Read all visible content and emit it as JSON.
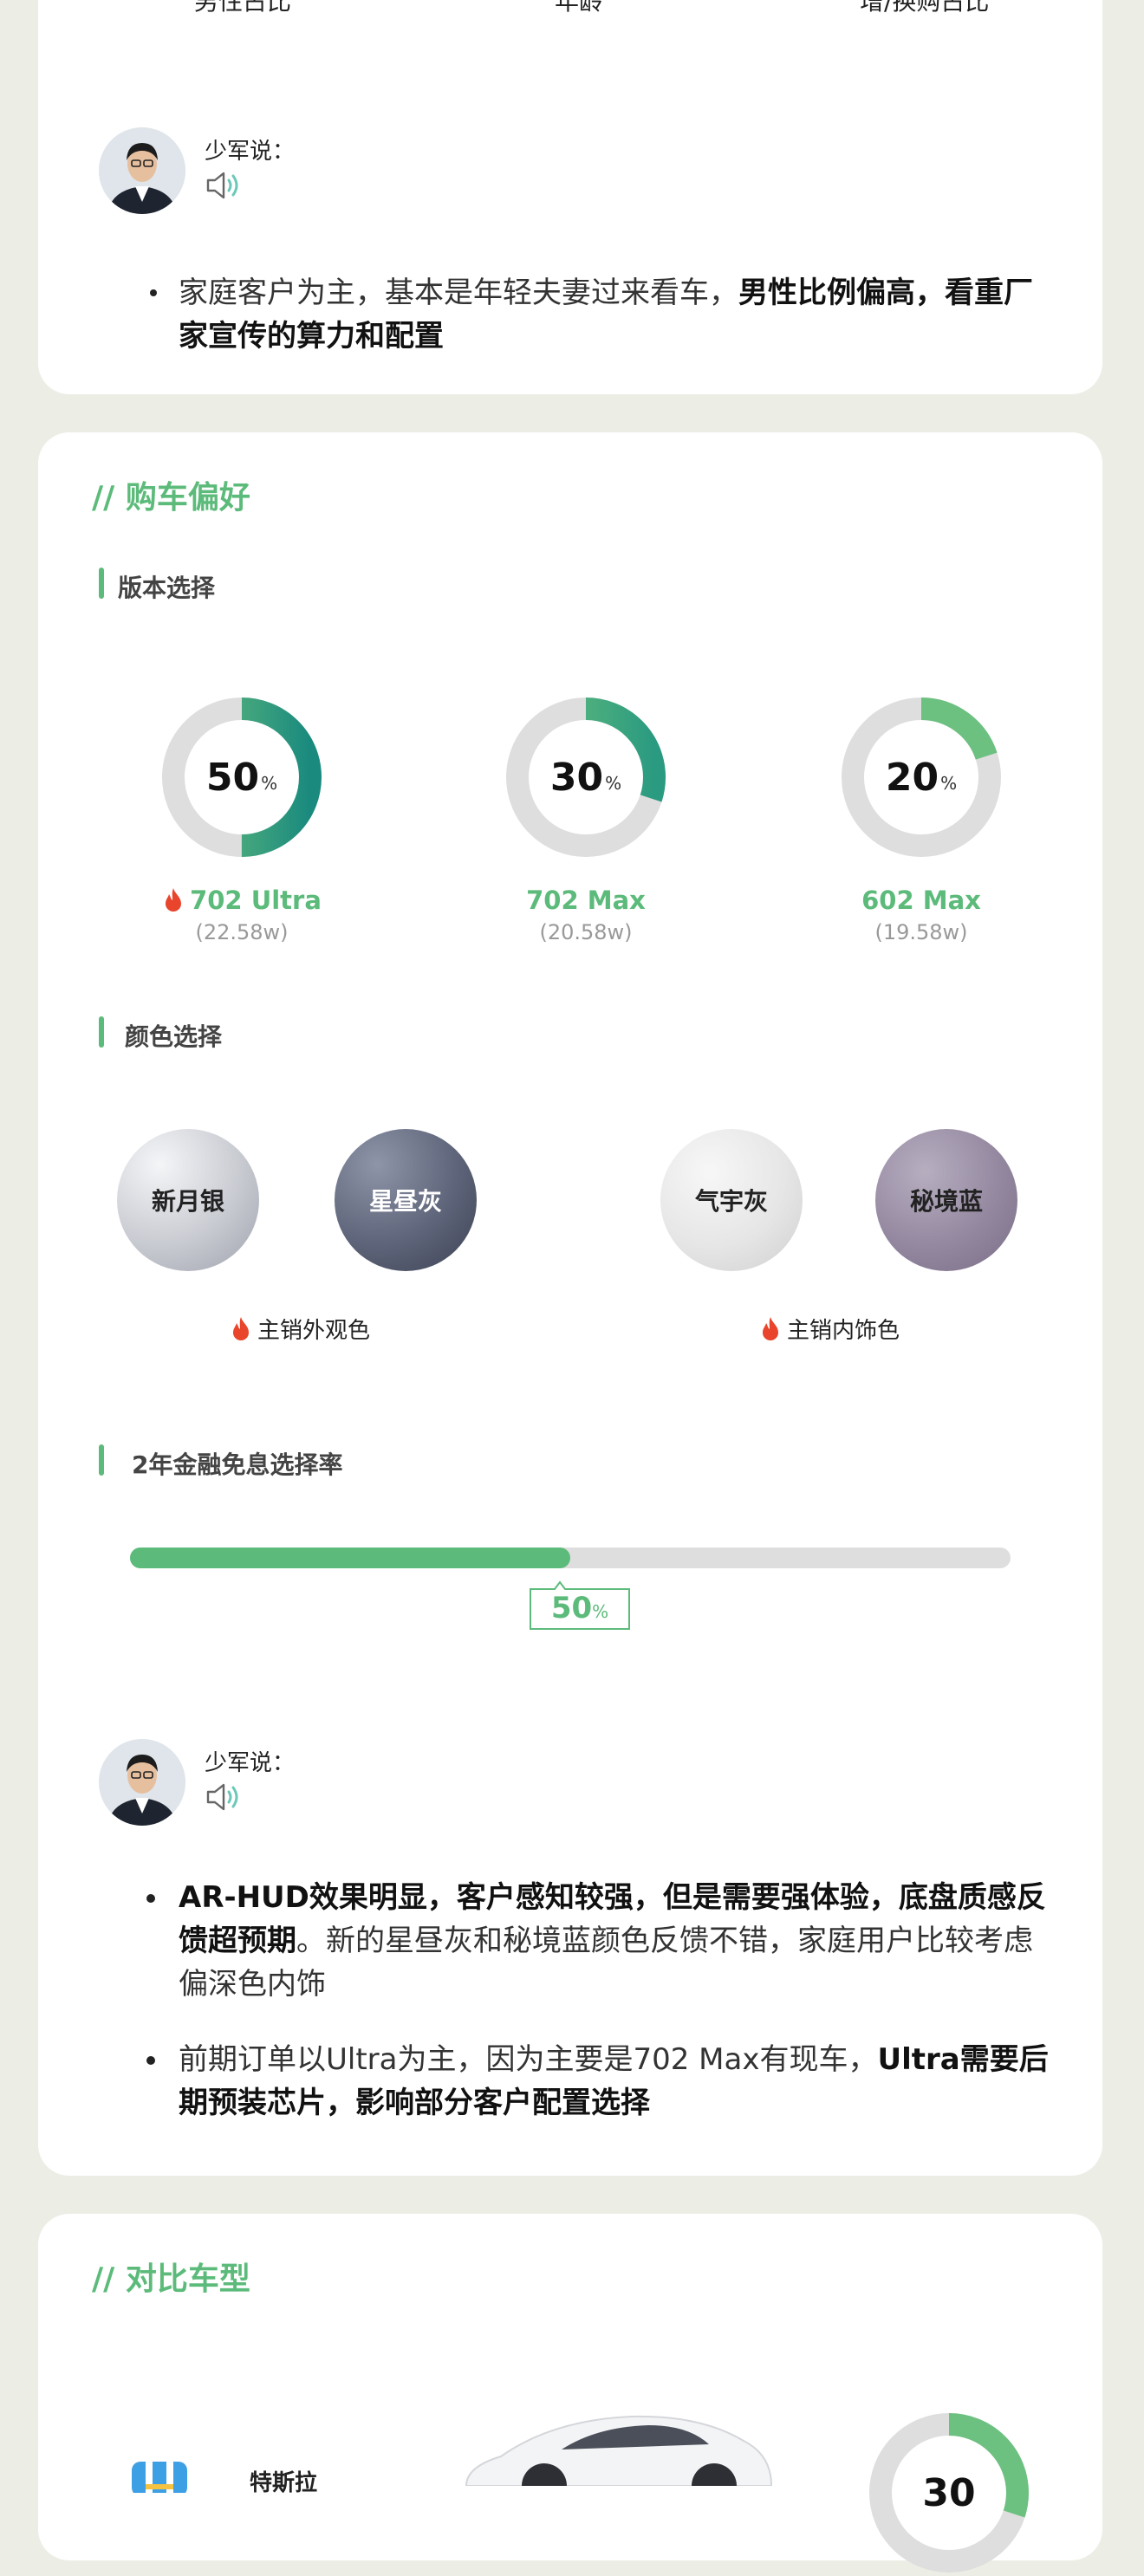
{
  "card1": {
    "top_labels": [
      "男性占比",
      "年龄",
      "增/换购占比"
    ],
    "say_label": "少军说：",
    "bullet": {
      "normal": "家庭客户为主，基本是年轻夫妻过来看车，",
      "bold": "男性比例偏高，看重厂家宣传的算力和配置"
    }
  },
  "card2": {
    "section_title": "// 购车偏好",
    "version_title": "版本选择",
    "versions": [
      {
        "value": "50",
        "pct": "%",
        "name": "702 Ultra",
        "price": "(22.58w)",
        "hot": true,
        "fraction": 0.5
      },
      {
        "value": "30",
        "pct": "%",
        "name": "702 Max",
        "price": "(20.58w)",
        "hot": false,
        "fraction": 0.3
      },
      {
        "value": "20",
        "pct": "%",
        "name": "602 Max",
        "price": "(19.58w)",
        "hot": false,
        "fraction": 0.2
      }
    ],
    "color_title": "颜色选择",
    "colors": [
      "新月银",
      "星昼灰",
      "气宇灰",
      "秘境蓝"
    ],
    "exterior_label": "主销外观色",
    "interior_label": "主销内饰色",
    "finance_title": "2年金融免息选择率",
    "finance": {
      "value": "50",
      "pct": "%",
      "fraction": 0.5
    },
    "say_label": "少军说：",
    "bullets": [
      {
        "bold": "AR-HUD效果明显，客户感知较强，但是需要强体验，底盘质感反馈超预期",
        "normal": "。新的星昼灰和秘境蓝颜色反馈不错，家庭用户比较考虑偏深色内饰"
      },
      {
        "normal": "前期订单以Ultra为主，因为主要是702 Max有现车，",
        "bold": "Ultra需要后期预装芯片，影响部分客户配置选择"
      }
    ]
  },
  "card3": {
    "section_title": "// 对比车型",
    "brand": "特斯拉",
    "ring_value": "30"
  },
  "colors": {
    "accent": "#5cbb7a",
    "ring_track": "#dedede",
    "flame": "#e8452c"
  }
}
